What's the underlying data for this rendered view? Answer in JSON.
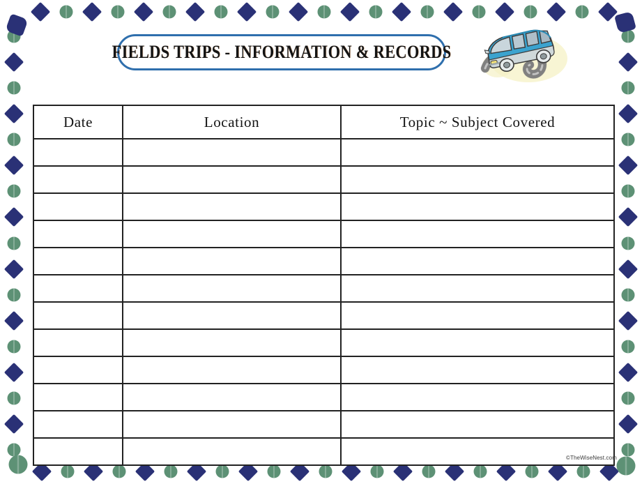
{
  "page": {
    "title": "FIELDS TRIPS - INFORMATION & RECORDS",
    "copyright": "©TheWiseNest.com",
    "background_color": "#ffffff"
  },
  "title_plaque": {
    "label": "FIELDS TRIPS - INFORMATION & RECORDS",
    "border_color": "#2f6fad",
    "text_color": "#141414"
  },
  "clipart": {
    "name": "blue-van-on-road",
    "van_body_color": "#3ba3cf",
    "van_body_dark": "#1b7fa8",
    "van_window_color": "#b8c6cc",
    "road_color": "#8e8e8e",
    "road_highlight": "#d8d8d8",
    "glow_color": "#f2eebe",
    "outline_color": "#3a3a3a"
  },
  "border": {
    "diamond_color": "#2a3176",
    "circle_color": "#5d9175",
    "corner_blob_color": "#2a3176",
    "corner_circle_color": "#5d9175",
    "pattern": "alternating-diamond-circle"
  },
  "table": {
    "border_color": "#222222",
    "columns": [
      {
        "key": "date",
        "label": "Date"
      },
      {
        "key": "location",
        "label": "Location"
      },
      {
        "key": "topic",
        "label": "Topic ~ Subject Covered"
      }
    ],
    "row_count": 12,
    "rows": [
      {
        "date": "",
        "location": "",
        "topic": ""
      },
      {
        "date": "",
        "location": "",
        "topic": ""
      },
      {
        "date": "",
        "location": "",
        "topic": ""
      },
      {
        "date": "",
        "location": "",
        "topic": ""
      },
      {
        "date": "",
        "location": "",
        "topic": ""
      },
      {
        "date": "",
        "location": "",
        "topic": ""
      },
      {
        "date": "",
        "location": "",
        "topic": ""
      },
      {
        "date": "",
        "location": "",
        "topic": ""
      },
      {
        "date": "",
        "location": "",
        "topic": ""
      },
      {
        "date": "",
        "location": "",
        "topic": ""
      },
      {
        "date": "",
        "location": "",
        "topic": ""
      },
      {
        "date": "",
        "location": "",
        "topic": ""
      }
    ]
  }
}
